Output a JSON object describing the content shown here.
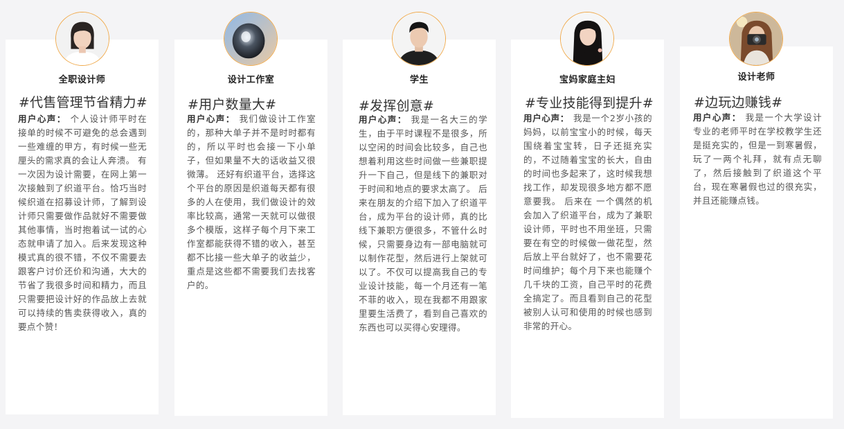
{
  "testimonials": [
    {
      "role": "全职设计师",
      "tag": "#代售管理节省精力#",
      "label": "用户心声：",
      "text": "个人设计师平时在接单的时候不可避免的总会遇到一些难缠的甲方，有时候一些无厘头的需求真的会让人奔溃。 有一次因为设计需要，在网上第一次接触到了织道平台。恰巧当时候织道在招募设计师，了解到设计师只需要做作品就好不需要做其他事情，当时抱着试一试的心态就申请了加入。后来发现这种模式真的很不错，不仅不需要去跟客户讨价还价和沟通，大大的节省了我很多时间和精力，而且只需要把设计好的作品放上去就可以持续的售卖获得收入，真的要点个赞！",
      "avatar_icon": "woman-portrait-avatar"
    },
    {
      "role": "设计工作室",
      "tag": "#用户数量大#",
      "label": "用户心声：",
      "text": "我们做设计工作室的，那种大单子并不是时时都有的，所以平时也会接一下小单子，但如果量不大的话收益又很微薄。 还好有织道平台，选择这个平台的原因是织道每天都有很多的人在使用，我们做设计的效率比较高，通常一天就可以做很多个模版，这样子每个月下来工作室都能获得不错的收入，甚至都不比接一些大单子的收益少，重点是这些都不需要我们去找客户的。",
      "avatar_icon": "camera-lens-avatar"
    },
    {
      "role": "学生",
      "tag": "#发挥创意#",
      "label": "用户心声：",
      "text": "我是一名大三的学生，由于平时课程不是很多，所以空闲的时间会比较多，自己也想着利用这些时间做一些兼职提升一下自己，但是线下的兼职对于时间和地点的要求太高了。 后来在朋友的介绍下加入了织道平台，成为平台的设计师，真的比线下兼职方便很多，不管什么时候，只需要身边有一部电脑就可以制作花型，然后进行上架就可以了。不仅可以提高我自己的专业设计技能，每一个月还有一笔不菲的收入，现在我都不用跟家里要生活费了，看到自己喜欢的东西也可以买得心安理得。",
      "avatar_icon": "young-man-avatar"
    },
    {
      "role": "宝妈家庭主妇",
      "tag": "#专业技能得到提升#",
      "label": "用户心声：",
      "text": "我是一个2岁小孩的妈妈，以前宝宝小的时候，每天围绕着宝宝转，日子还挺充实的，不过随着宝宝的长大，自由的时间也多起来了，这时候我想找工作，却发现很多地方都不愿意要我。 后来在 一个偶然的机会加入了织道平台，成为了兼职设计师，平时也不用坐班，只需要在有空的时候做一做花型，然后放上平台就好了，也不需要花时间维护；每个月下来也能赚个几千块的工资，自己平时的花费全搞定了。而且看到自己的花型被别人认可和使用的时候也感到非常的开心。",
      "avatar_icon": "long-hair-woman-avatar"
    },
    {
      "role": "设计老师",
      "tag": "#边玩边赚钱#",
      "label": "用户心声：",
      "text": "我是一个大学设计专业的老师平时在学校教学生还是挺充实的，但是一到寒暑假，玩了一两个礼拜，就有点无聊了，然后接触到了织道这个平台，现在寒暑假也过的很充实，并且还能赚点钱。",
      "avatar_icon": "photographer-avatar"
    }
  ],
  "colors": {
    "avatar_border": "#f0a94a",
    "card_bg": "#ffffff",
    "page_bg": "#f4f4f6"
  }
}
